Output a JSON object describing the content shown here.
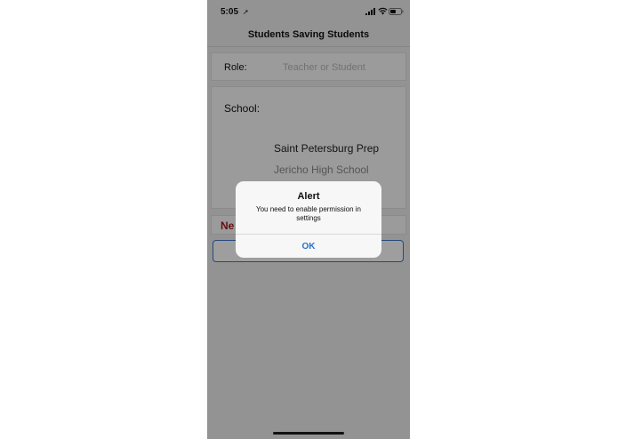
{
  "status_bar": {
    "time": "5:05",
    "icons": [
      "location-arrow-icon",
      "signal-icon",
      "wifi-icon",
      "battery-icon"
    ]
  },
  "nav": {
    "title": "Students Saving Students"
  },
  "form": {
    "role": {
      "label": "Role:",
      "placeholder": "Teacher or Student",
      "value": ""
    },
    "school": {
      "label": "School:",
      "options": [
        "Saint Petersburg Prep",
        "Jericho High School"
      ]
    },
    "next_label_visible": "Ne"
  },
  "alert": {
    "title": "Alert",
    "message": "You need to enable permission in settings",
    "ok_label": "OK"
  },
  "colors": {
    "accent": "#2b6fcf",
    "next_red": "#a8181c",
    "overlay": "rgba(0,0,0,0.38)"
  }
}
